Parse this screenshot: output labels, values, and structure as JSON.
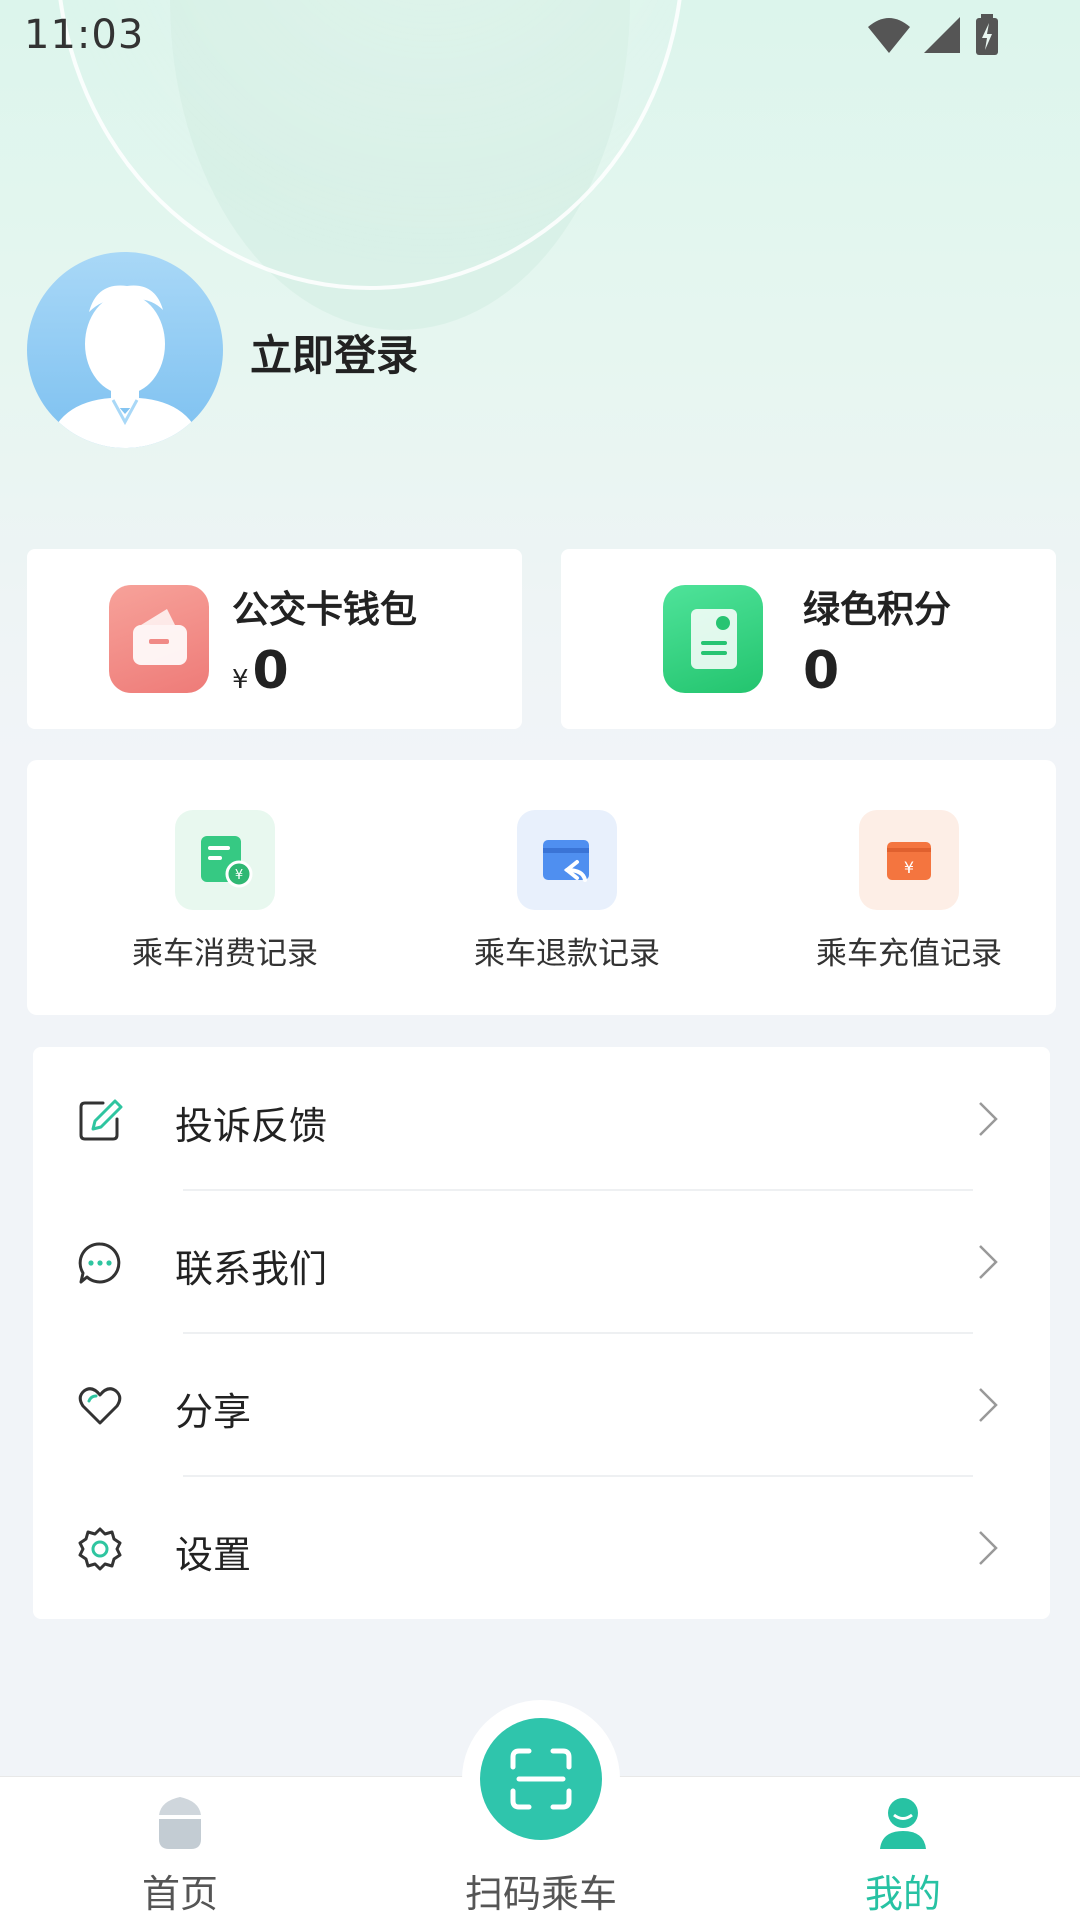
{
  "status_bar": {
    "time": "11:03"
  },
  "profile": {
    "login_label": "立即登录"
  },
  "cards": {
    "wallet": {
      "title": "公交卡钱包",
      "currency": "¥",
      "value": "0",
      "accent": "#f07f7f"
    },
    "points": {
      "title": "绿色积分",
      "value": "0",
      "accent": "#2fcf7c"
    }
  },
  "records": [
    {
      "label": "乘车消费记录",
      "icon": "consumption-record-icon",
      "color": "#36c983"
    },
    {
      "label": "乘车退款记录",
      "icon": "refund-record-icon",
      "color": "#4f8ff0"
    },
    {
      "label": "乘车充值记录",
      "icon": "recharge-record-icon",
      "color": "#f4753f"
    }
  ],
  "menu": [
    {
      "label": "投诉反馈",
      "icon": "edit-icon"
    },
    {
      "label": "联系我们",
      "icon": "chat-icon"
    },
    {
      "label": "分享",
      "icon": "heart-icon"
    },
    {
      "label": "设置",
      "icon": "gear-icon"
    }
  ],
  "bottom_nav": {
    "home": "首页",
    "scan": "扫码乘车",
    "mine": "我的",
    "active": "mine",
    "accent": "#27c2a3"
  }
}
